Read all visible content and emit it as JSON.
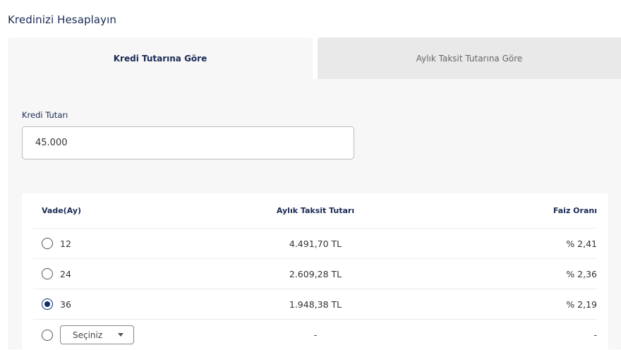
{
  "page": {
    "title": "Kredinizi Hesaplayın"
  },
  "tabs": [
    {
      "label": "Kredi Tutarına Göre",
      "active": true
    },
    {
      "label": "Aylık Taksit Tutarına Göre",
      "active": false
    }
  ],
  "form": {
    "amount_label": "Kredi Tutarı",
    "amount_value": "45.000"
  },
  "table": {
    "headers": {
      "vade": "Vade(Ay)",
      "taksit": "Aylık Taksit Tutarı",
      "faiz": "Faiz Oranı"
    },
    "rows": [
      {
        "vade": "12",
        "taksit": "4.491,70 TL",
        "faiz": "% 2,41",
        "selected": false
      },
      {
        "vade": "24",
        "taksit": "2.609,28 TL",
        "faiz": "% 2,36",
        "selected": false
      },
      {
        "vade": "36",
        "taksit": "1.948,38 TL",
        "faiz": "% 2,19",
        "selected": true
      }
    ],
    "custom_row": {
      "select_label": "Seçiniz",
      "taksit": "-",
      "faiz": "-",
      "selected": false
    }
  },
  "colors": {
    "accent": "#0f2c6e",
    "title": "#1a2a55"
  },
  "icons": {
    "select_caret": "caret-down-icon"
  }
}
